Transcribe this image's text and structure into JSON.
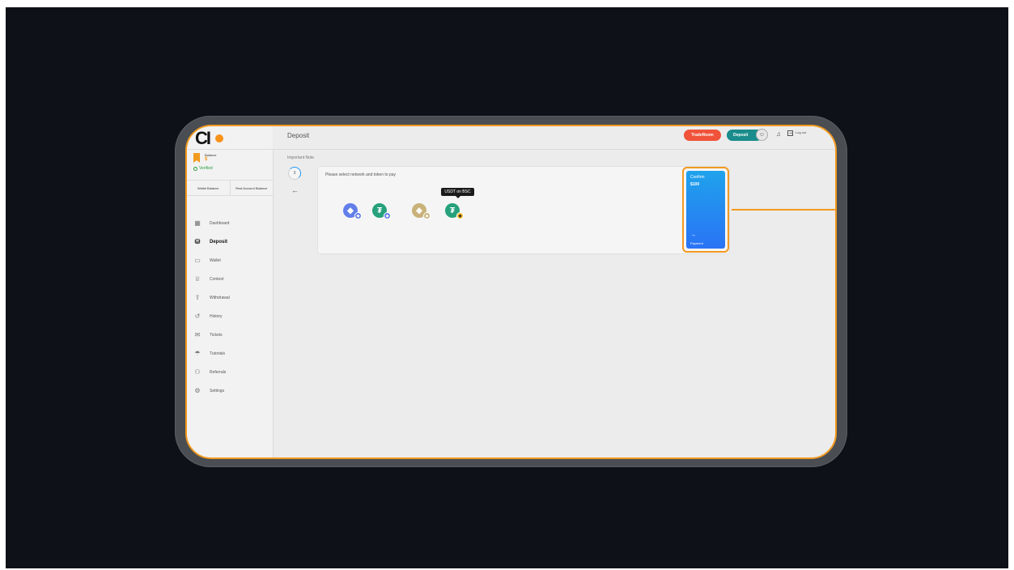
{
  "app": {
    "logo_text": "CI",
    "page_title": "Deposit"
  },
  "sidebar": {
    "balance_label": "Balance",
    "balance_amount": "$",
    "verified": "Verified",
    "wallet_balance": "Wallet Balance",
    "real_account_balance": "Real Account Balance",
    "items": [
      {
        "label": "Dashboard",
        "icon": "dashboard-icon",
        "active": false
      },
      {
        "label": "Deposit",
        "icon": "deposit-icon",
        "active": true
      },
      {
        "label": "Wallet",
        "icon": "wallet-icon",
        "active": false
      },
      {
        "label": "Contest",
        "icon": "trophy-icon",
        "active": false
      },
      {
        "label": "Withdrawal",
        "icon": "withdrawal-icon",
        "active": false
      },
      {
        "label": "History",
        "icon": "history-icon",
        "active": false
      },
      {
        "label": "Tickets",
        "icon": "tickets-icon",
        "active": false
      },
      {
        "label": "Tutorials",
        "icon": "tutorials-icon",
        "active": false
      },
      {
        "label": "Referrals",
        "icon": "referrals-icon",
        "active": false
      },
      {
        "label": "Settings",
        "icon": "settings-icon",
        "active": false
      }
    ]
  },
  "header": {
    "traderoom_label": "TradeRoom",
    "deposit_label": "Deposit",
    "logout_label": "Log out"
  },
  "main": {
    "important_note": "Important Note",
    "step_number": "3",
    "instruction": "Please select network and token to pay",
    "tooltip": "USDT on BSC",
    "tokens": [
      {
        "name": "ETH on ETH",
        "color": "#627eea"
      },
      {
        "name": "USDT on ETH",
        "color": "#26a17b"
      },
      {
        "name": "BNB on BSC",
        "color": "#f3ba2f"
      },
      {
        "name": "USDT on BSC",
        "color": "#26a17b"
      }
    ]
  },
  "confirm": {
    "title": "Confirm",
    "amount": "$100",
    "payment": "Payment"
  },
  "colors": {
    "accent_orange": "#f29a1f",
    "traderoom": "#f0533a",
    "deposit": "#1a8c8c",
    "confirm_blue": "#2a73f5"
  }
}
